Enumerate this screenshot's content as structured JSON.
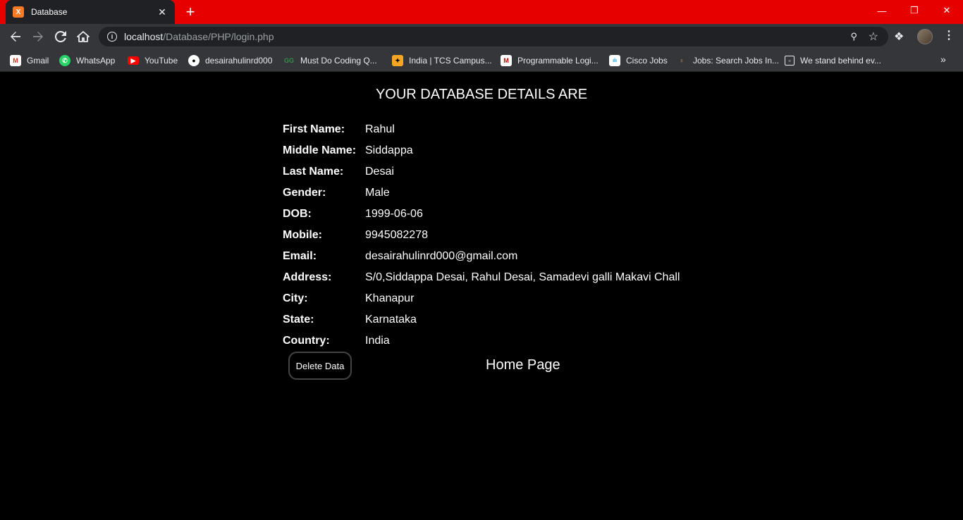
{
  "browser": {
    "tab_title": "Database",
    "tab_favicon": "X",
    "url_host": "localhost",
    "url_path": "/Database/PHP/login.php",
    "bookmarks": [
      {
        "label": "Gmail",
        "icon": "gmail-icon"
      },
      {
        "label": "WhatsApp",
        "icon": "whatsapp-icon"
      },
      {
        "label": "YouTube",
        "icon": "youtube-icon"
      },
      {
        "label": "desairahulinrd000",
        "icon": "github-icon"
      },
      {
        "label": "Must Do Coding Q...",
        "icon": "gfg-icon"
      },
      {
        "label": "India | TCS Campus...",
        "icon": "tcs-icon"
      },
      {
        "label": "Programmable Logi...",
        "icon": "plc-icon"
      },
      {
        "label": "Cisco Jobs",
        "icon": "cisco-icon"
      },
      {
        "label": "Jobs: Search Jobs In...",
        "icon": "jobs-icon"
      },
      {
        "label": "We stand behind ev...",
        "icon": "page-icon"
      }
    ],
    "bookmarks_more": "»"
  },
  "page": {
    "heading": "YOUR DATABASE DETAILS ARE",
    "details": [
      {
        "label": "First Name:",
        "value": "Rahul"
      },
      {
        "label": "Middle Name:",
        "value": "Siddappa"
      },
      {
        "label": "Last Name:",
        "value": "Desai"
      },
      {
        "label": "Gender:",
        "value": "Male"
      },
      {
        "label": "DOB:",
        "value": "1999-06-06"
      },
      {
        "label": "Mobile:",
        "value": "9945082278"
      },
      {
        "label": "Email:",
        "value": "desairahulinrd000@gmail.com"
      },
      {
        "label": "Address:",
        "value": "S/0,Siddappa Desai, Rahul Desai, Samadevi galli Makavi Chall"
      },
      {
        "label": "City:",
        "value": "Khanapur"
      },
      {
        "label": "State:",
        "value": "Karnataka"
      },
      {
        "label": "Country:",
        "value": "India"
      }
    ],
    "delete_button": "Delete Data",
    "home_link": "Home Page"
  }
}
